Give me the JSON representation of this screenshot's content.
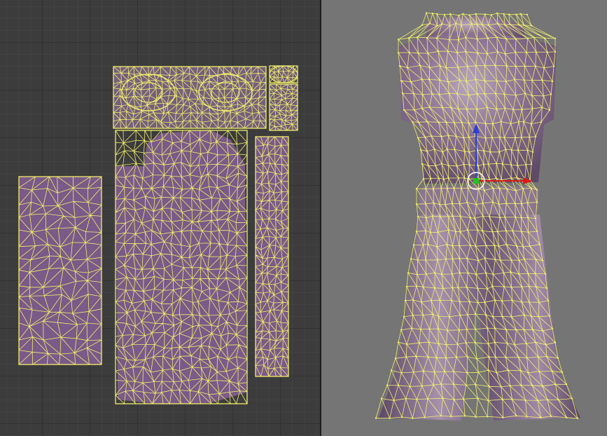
{
  "app": {
    "panels": [
      "uv-image-editor",
      "3d-viewport"
    ]
  },
  "colors": {
    "uv_background": "#3c3c3c",
    "uv_grid_minor": "#494949",
    "uv_grid_major": "#2b2b2b",
    "viewport_background": "#757575",
    "uv_face_fill": "#7a5a88",
    "wire": "#f2ee6c",
    "mesh_shade": "#7d6686",
    "mesh_highlight": "#b8a7bd",
    "gizmo_z": "#2b3fd6",
    "gizmo_x": "#d81c1c",
    "gizmo_center": "#21c421",
    "gizmo_circle": "#ffffff"
  },
  "icons": {
    "transform_gizmo": "transform-manipulator-icon",
    "pivot": "pivot-point-icon"
  }
}
